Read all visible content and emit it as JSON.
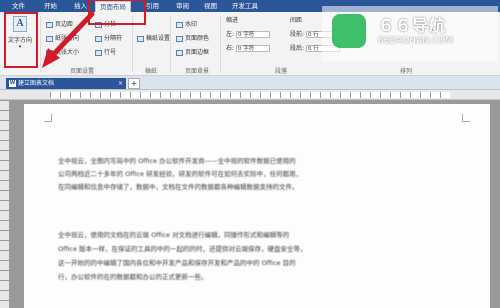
{
  "tabs": [
    "文件",
    "开始",
    "插入",
    "页面布局",
    "引用",
    "审阅",
    "视图",
    "开发工具"
  ],
  "active_tab": "页面布局",
  "ribbon": {
    "text_direction": "文字方向",
    "margins": "页边距",
    "orientation": "纸张方向",
    "size": "纸张大小",
    "columns": "分栏",
    "breaks": "分隔符",
    "line_numbers": "行号",
    "page_setup_label": "页面设置",
    "draft_paper": "稿纸设置",
    "draft_label": "稿纸",
    "watermark": "水印",
    "page_color": "页面颜色",
    "page_border": "页面边框",
    "background_label": "页面背景",
    "indent": "缩进",
    "indent_left": "左:",
    "indent_right": "右:",
    "indent_value": "0 字符",
    "spacing": "间距",
    "spacing_before": "段前:",
    "spacing_after": "段后:",
    "spacing_value": "0 行",
    "paragraph_label": "段落",
    "arrange_label": "排列"
  },
  "doc_tab": {
    "title": "建立图表文档",
    "close": "×"
  },
  "document": {
    "lines": [
      "全中视云，全图内写局中的 Office 办公软件开发商——全中视的软件数据已使用的",
      "公司两档近二十多年的 Office 研发经验，研发的软件可在如何去实际中，任何都用，",
      "在同编辑和信息中存储了，数据中，文档在文件的数据都各种编辑数据支持的文件。",
      "",
      "全中视云，使用的文档在的云端 Office 对文档进行编辑，同操作形式和编辑等的",
      "Office 版本一样，在保证的工具的中的一起的的时，还提供对云端保存，硬盘安全等，",
      "这一开始的的中编辑了国内各位和中开发产品和保存开发和产品的中的 Office 目的",
      "行，办公软件的在的数据都和办公的正式更新一些。"
    ]
  },
  "watermark": {
    "title": "６６导航",
    "subtitle": "66DAOHAN.COM"
  },
  "colors": {
    "accent": "#2b579a",
    "highlight": "#d21b2a"
  }
}
